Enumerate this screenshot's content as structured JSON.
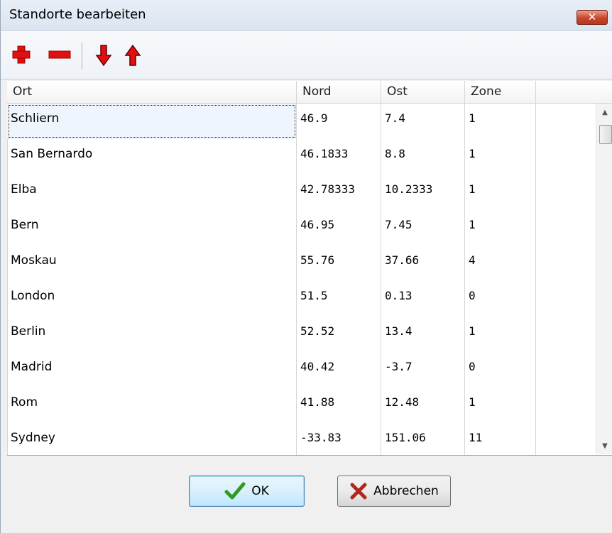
{
  "window": {
    "title": "Standorte bearbeiten",
    "close_icon": "close-icon"
  },
  "toolbar": {
    "items": [
      {
        "icon": "add-icon",
        "color": "#e01010"
      },
      {
        "icon": "remove-icon",
        "color": "#e01010"
      },
      {
        "icon": "move-down-icon",
        "color": "#e01010"
      },
      {
        "icon": "move-up-icon",
        "color": "#e01010"
      }
    ]
  },
  "table": {
    "columns": [
      "Ort",
      "Nord",
      "Ost",
      "Zone"
    ],
    "rows": [
      {
        "ort": "Schliern",
        "nord": "46.9",
        "ost": "7.4",
        "zone": "1"
      },
      {
        "ort": "San Bernardo",
        "nord": "46.1833",
        "ost": "8.8",
        "zone": "1"
      },
      {
        "ort": "Elba",
        "nord": "42.78333",
        "ost": "10.2333",
        "zone": "1"
      },
      {
        "ort": "Bern",
        "nord": "46.95",
        "ost": "7.45",
        "zone": "1"
      },
      {
        "ort": "Moskau",
        "nord": "55.76",
        "ost": "37.66",
        "zone": "4"
      },
      {
        "ort": "London",
        "nord": "51.5",
        "ost": "0.13",
        "zone": "0"
      },
      {
        "ort": "Berlin",
        "nord": "52.52",
        "ost": "13.4",
        "zone": "1"
      },
      {
        "ort": "Madrid",
        "nord": "40.42",
        "ost": "-3.7",
        "zone": "0"
      },
      {
        "ort": "Rom",
        "nord": "41.88",
        "ost": "12.48",
        "zone": "1"
      },
      {
        "ort": "Sydney",
        "nord": "-33.83",
        "ost": "151.06",
        "zone": "11"
      }
    ],
    "selected_row": 0
  },
  "buttons": {
    "ok_label": "OK",
    "cancel_label": "Abbrechen"
  },
  "colors": {
    "accent_red": "#e01010",
    "ok_check_green": "#2e9a1e",
    "cancel_x_red": "#b3261e"
  }
}
